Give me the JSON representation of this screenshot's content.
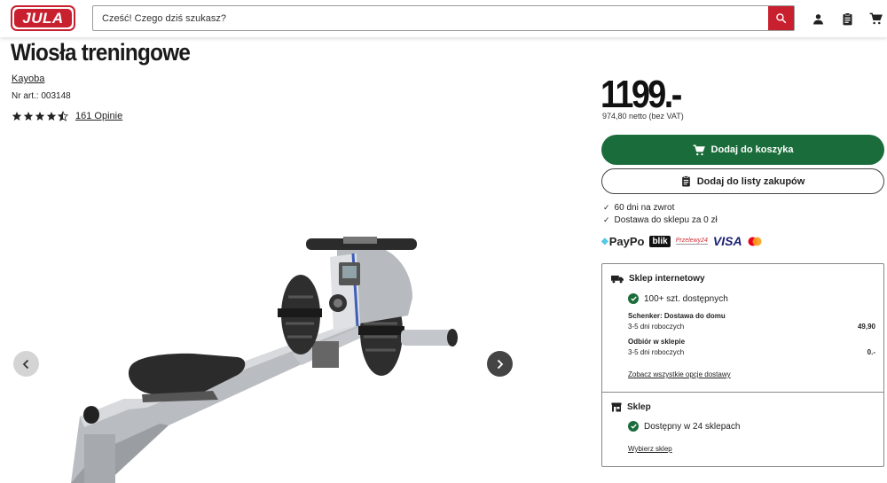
{
  "header": {
    "logo_text": "JULA",
    "search_placeholder": "Cześć! Czego dziś szukasz?",
    "icons": [
      "search-icon",
      "user-icon",
      "shopping-list-icon",
      "cart-icon"
    ]
  },
  "product": {
    "title": "Wiosła treningowe",
    "brand": "Kayoba",
    "article_number": "Nr art.: 003148",
    "rating": 4.5,
    "reviews_label": "161 Opinie"
  },
  "gallery": {
    "prev_icon": "chevron-left-icon",
    "next_icon": "chevron-right-icon"
  },
  "pricing": {
    "price": "1199.-",
    "netto": "974,80 netto (bez VAT)"
  },
  "actions": {
    "add_to_cart": "Dodaj do koszyka",
    "add_to_list": "Dodaj do listy zakupów"
  },
  "usps": [
    "60 dni na zwrot",
    "Dostawa do sklepu za 0 zł"
  ],
  "payments": {
    "paypo": "PayPo",
    "blik": "blik",
    "przelewy": "Przelewy24",
    "visa": "VISA"
  },
  "online_store": {
    "title": "Sklep internetowy",
    "availability": "100+ szt. dostępnych",
    "options": [
      {
        "name": "Schenker: Dostawa do domu",
        "time": "3-5 dni roboczych",
        "price": "49,90"
      },
      {
        "name": "Odbiór w sklepie",
        "time": "3-5 dni roboczych",
        "price": "0.-"
      }
    ],
    "link": "Zobacz wszystkie opcje dostawy"
  },
  "store": {
    "title": "Sklep",
    "availability": "Dostępny w 24 sklepach",
    "link": "Wybierz sklep"
  },
  "colors": {
    "brand_red": "#c8202e",
    "cart_green": "#1a6d3a"
  }
}
